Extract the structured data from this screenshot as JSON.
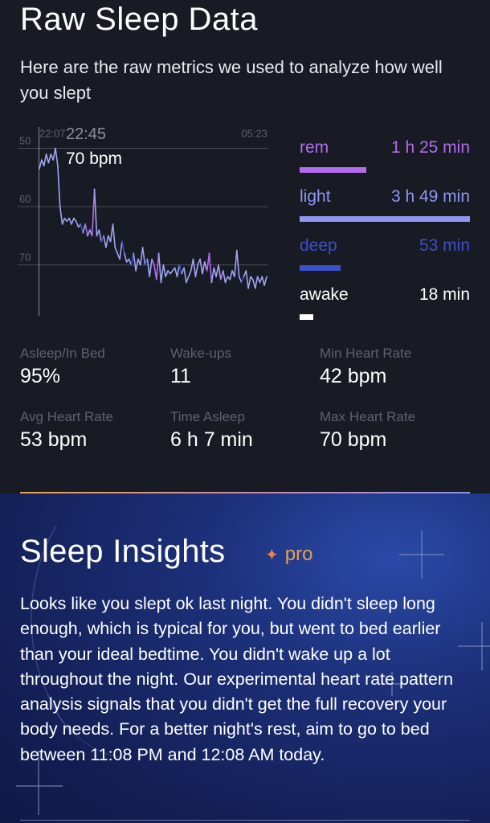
{
  "raw": {
    "title": "Raw Sleep Data",
    "subtitle": "Here are the raw metrics we used to analyze how well you slept"
  },
  "chart": {
    "tooltip_time": "22:45",
    "tooltip_bpm": "70 bpm",
    "start_label": "22:07",
    "end_label": "05:23",
    "y_ticks": [
      "70",
      "60",
      "50"
    ]
  },
  "chart_data": {
    "type": "line",
    "title": "",
    "xlabel": "",
    "ylabel": "",
    "x_start": "22:07",
    "x_end": "05:23",
    "ylim": [
      41,
      72
    ],
    "y_ticks": [
      50,
      60,
      70
    ],
    "grid": true,
    "cursor_time": "22:45",
    "cursor_value": 70,
    "series": [
      {
        "values": [
          66.5,
          68,
          67,
          69,
          67.5,
          69,
          68,
          70,
          67,
          60,
          57,
          58,
          57.5,
          58,
          57,
          58,
          57.5,
          56.5,
          57,
          55.5,
          57,
          55,
          56,
          55,
          63,
          55,
          56,
          54,
          55,
          53,
          55,
          54,
          57,
          53,
          52,
          51,
          54,
          52,
          50.5,
          51,
          50,
          52,
          49,
          51,
          50,
          53,
          50,
          51,
          48,
          51,
          50,
          47.5,
          52,
          47,
          50,
          48,
          49,
          48.5,
          49,
          49.5,
          48,
          50,
          48.5,
          49.5,
          47,
          48,
          49,
          51,
          48,
          50,
          51,
          48.5,
          50.5,
          49,
          52,
          47,
          49.5,
          48,
          50,
          47.5,
          49,
          47,
          48,
          47.5,
          49,
          48,
          52.5,
          48,
          47,
          48,
          49,
          46,
          48,
          47.5,
          46,
          48,
          47,
          48,
          46.5,
          48
        ],
        "stages": [
          "light",
          "light",
          "light",
          "light",
          "light",
          "light",
          "light",
          "light",
          "light",
          "light",
          "light",
          "light",
          "light",
          "light",
          "light",
          "light",
          "light",
          "light",
          "light",
          "deep",
          "light",
          "rem",
          "light",
          "light",
          "rem",
          "light",
          "light",
          "light",
          "deep",
          "light",
          "light",
          "light",
          "light",
          "light",
          "light",
          "light",
          "light",
          "deep",
          "light",
          "light",
          "light",
          "deep",
          "light",
          "light",
          "light",
          "light",
          "light",
          "deep",
          "light",
          "light",
          "rem",
          "rem",
          "rem",
          "light",
          "light",
          "light",
          "light",
          "light",
          "light",
          "light",
          "light",
          "light",
          "deep",
          "light",
          "light",
          "light",
          "light",
          "light",
          "light",
          "light",
          "light",
          "light",
          "light",
          "light",
          "rem",
          "rem",
          "light",
          "light",
          "light",
          "light",
          "rem",
          "light",
          "light",
          "light",
          "light",
          "light",
          "light",
          "light",
          "light",
          "deep",
          "light",
          "light",
          "light",
          "light",
          "light",
          "light",
          "light",
          "light",
          "light",
          "light"
        ]
      }
    ]
  },
  "legend": [
    {
      "name": "rem",
      "value": "1 h 25 min",
      "color": "#b46bf0",
      "fraction": 0.39
    },
    {
      "name": "light",
      "value": "3 h 49 min",
      "color": "#8f96f2",
      "fraction": 1.0
    },
    {
      "name": "deep",
      "value": "53 min",
      "color": "#3b50c9",
      "fraction": 0.24
    },
    {
      "name": "awake",
      "value": "18 min",
      "color": "#ffffff",
      "fraction": 0.08
    }
  ],
  "stats": [
    {
      "label": "Asleep/In Bed",
      "value": "95%"
    },
    {
      "label": "Wake-ups",
      "value": "11"
    },
    {
      "label": "Min Heart Rate",
      "value": "42 bpm"
    },
    {
      "label": "Avg Heart Rate",
      "value": "53 bpm"
    },
    {
      "label": "Time Asleep",
      "value": "6 h 7 min"
    },
    {
      "label": "Max Heart Rate",
      "value": "70 bpm"
    }
  ],
  "insights": {
    "title": "Sleep Insights",
    "pro_label": "pro",
    "body": "Looks like you slept ok last night. You didn't sleep long enough, which is typical for you, but went to bed earlier than your ideal bedtime. You didn't wake up a lot throughout the night. Our experimental heart rate pattern analysis signals that you didn't get the full recovery your body needs. For a better night's rest, aim to go to bed between 11:08 PM and 12:08 AM today."
  },
  "colors": {
    "background": "#181b23",
    "rem": "#b46bf0",
    "light": "#8f96f2",
    "deep": "#3b50c9",
    "awake": "#ffffff",
    "accent": "#e7a24a"
  }
}
